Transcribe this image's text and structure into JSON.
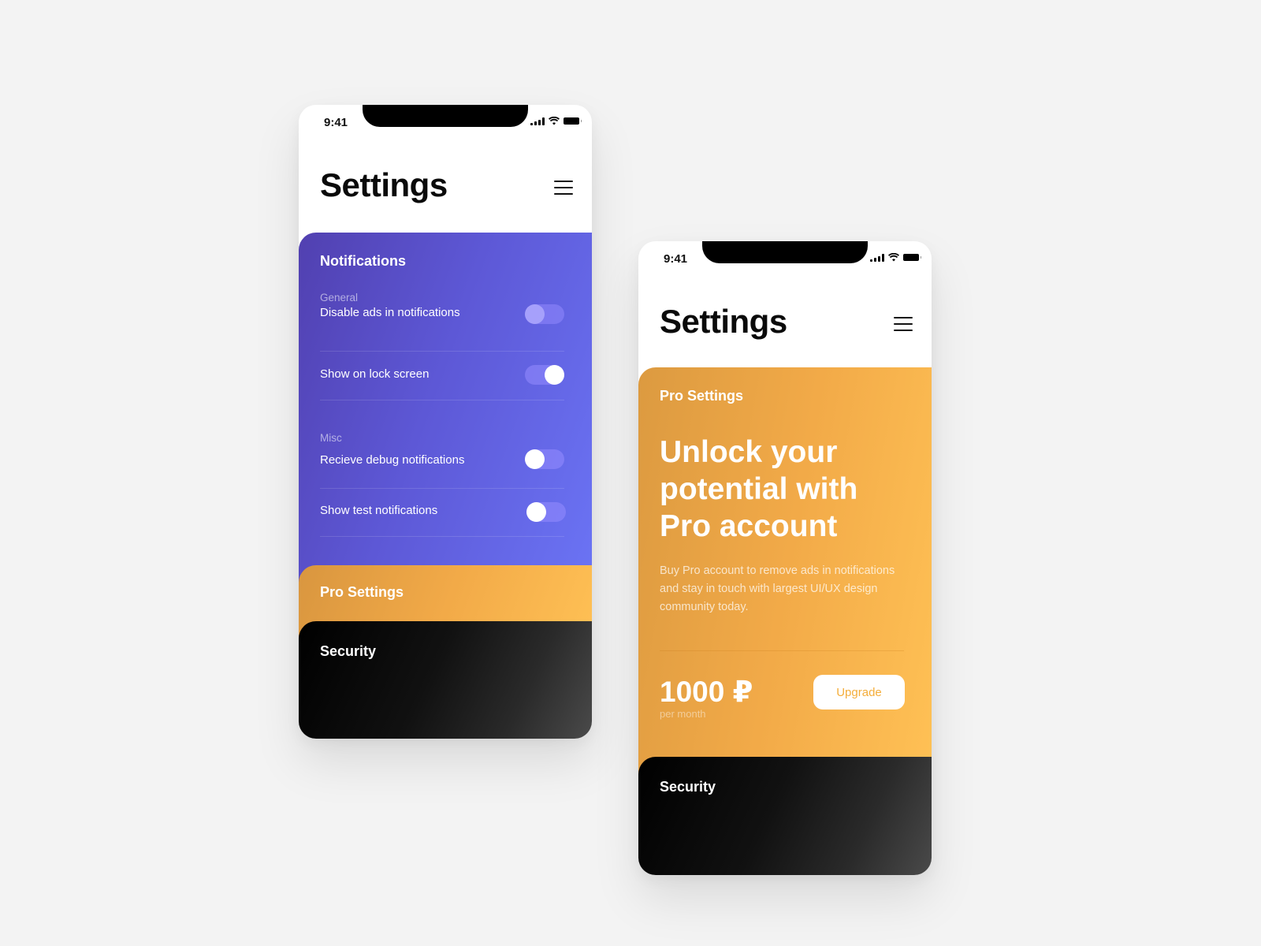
{
  "phones": [
    {
      "status_time": "9:41",
      "title": "Settings",
      "notifications": {
        "title": "Notifications",
        "groups": [
          {
            "label": "General",
            "items": [
              {
                "label": "Disable ads in notifications",
                "state": "disabled"
              },
              {
                "label": "Show on lock screen",
                "state": "on"
              }
            ]
          },
          {
            "label": "Misc",
            "items": [
              {
                "label": "Recieve debug notifications",
                "state": "off"
              },
              {
                "label": "Show test notifications",
                "state": "off"
              }
            ]
          }
        ]
      },
      "pro_settings_title": "Pro Settings",
      "security_title": "Security"
    },
    {
      "status_time": "9:41",
      "title": "Settings",
      "pro": {
        "title": "Pro Settings",
        "headline": "Unlock your potential with Pro account",
        "description": "Buy Pro account to remove ads in notifications and stay in touch with largest UI/UX design community today.",
        "price": "1000 ₽",
        "price_period": "per month",
        "upgrade_label": "Upgrade"
      },
      "security_title": "Security"
    }
  ],
  "colors": {
    "background": "#f3f3f3",
    "notifications_gradient": [
      "#5140b0",
      "#6b74f5"
    ],
    "pro_gradient": [
      "#d9963f",
      "#ffc155"
    ],
    "security_gradient": [
      "#000000",
      "#4a4a4a"
    ],
    "upgrade_text": "#f4ad3a"
  }
}
